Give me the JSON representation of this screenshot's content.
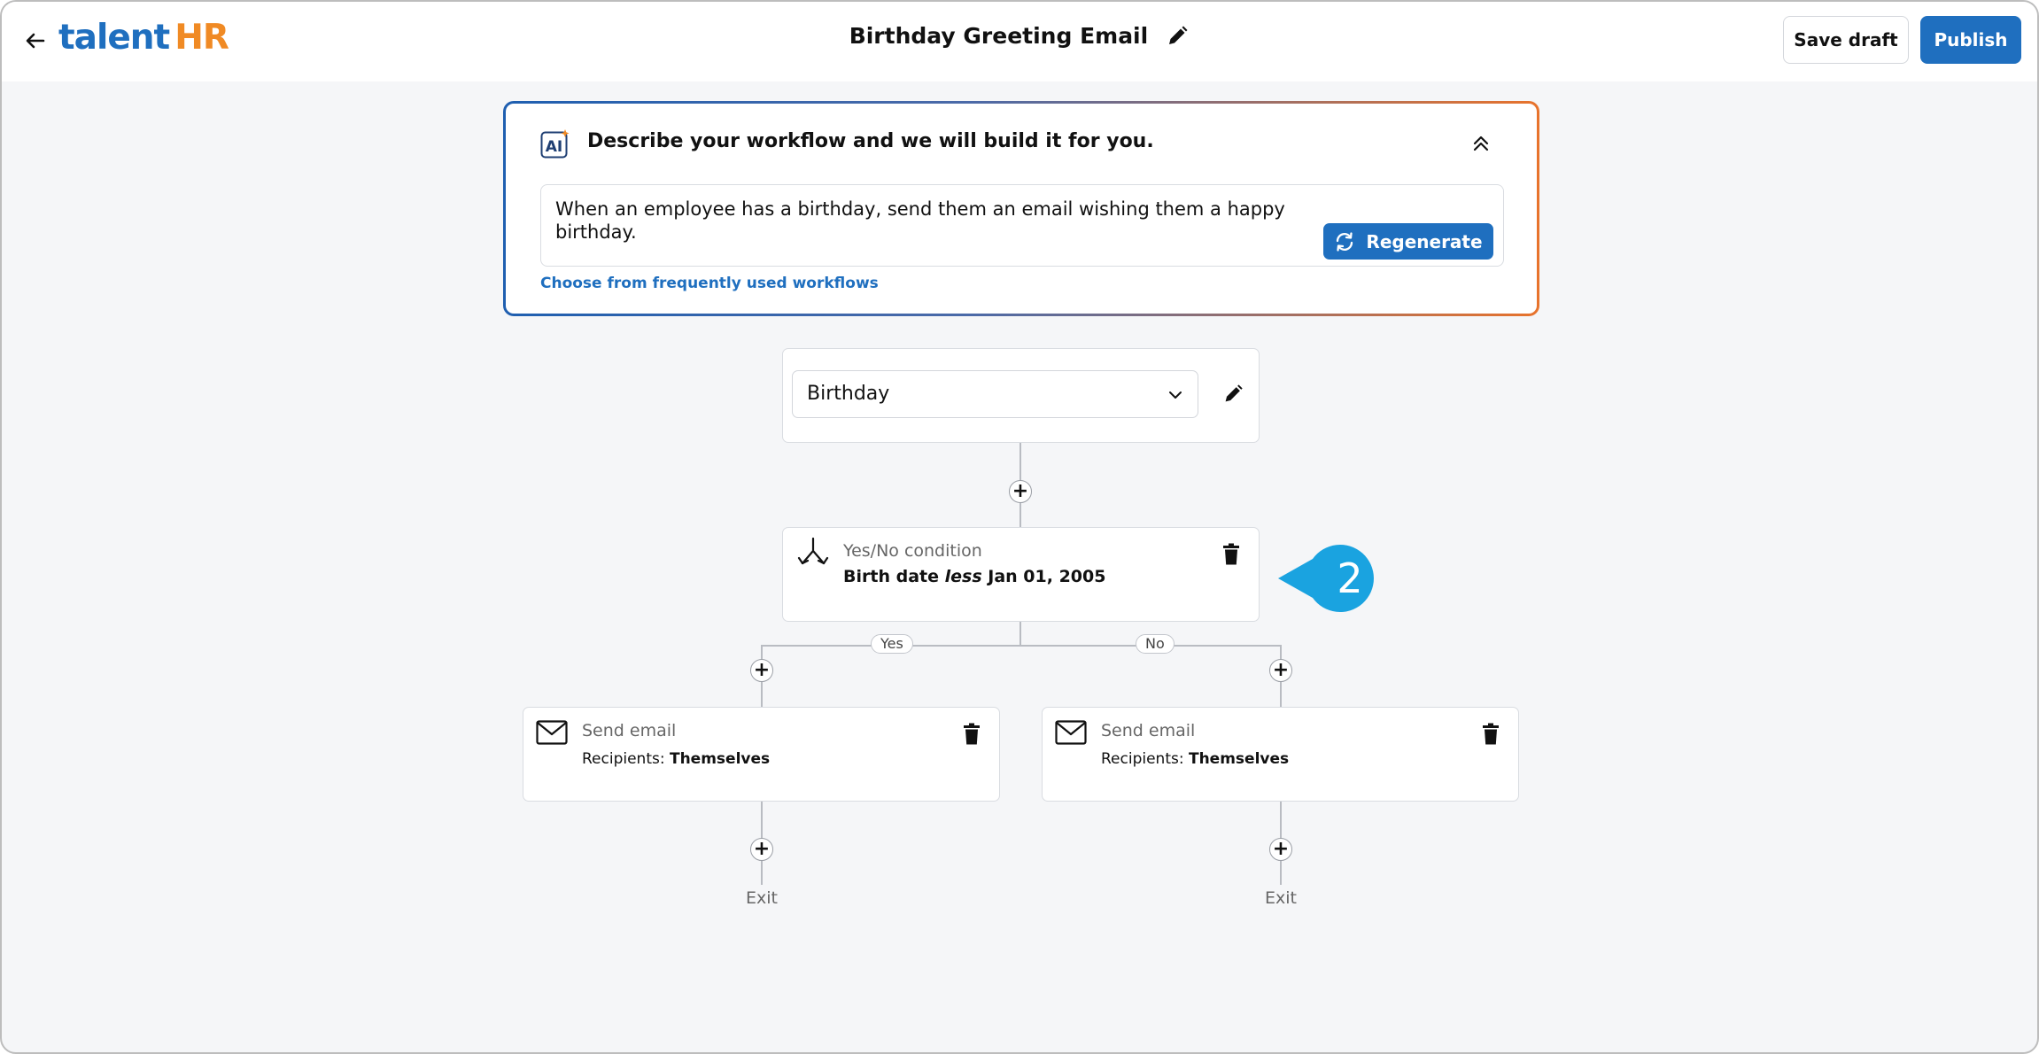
{
  "header": {
    "logo_talent": "talent",
    "logo_hr": "HR",
    "title": "Birthday Greeting Email",
    "save_draft_label": "Save draft",
    "publish_label": "Publish"
  },
  "ai_panel": {
    "badge_text": "AI",
    "heading": "Describe your workflow and we will build it for you.",
    "prompt": "When an employee has a birthday, send them an email wishing them a happy birthday.",
    "regenerate_label": "Regenerate",
    "frequent_link": "Choose from frequently used workflows"
  },
  "trigger": {
    "selected": "Birthday"
  },
  "condition": {
    "type_label": "Yes/No condition",
    "field": "Birth date",
    "operator": "less",
    "value": "Jan 01, 2005"
  },
  "branches": {
    "yes_label": "Yes",
    "no_label": "No"
  },
  "actions": [
    {
      "type_label": "Send email",
      "recipients_label": "Recipients:",
      "recipients_value": "Themselves"
    },
    {
      "type_label": "Send email",
      "recipients_label": "Recipients:",
      "recipients_value": "Themselves"
    }
  ],
  "exit_label": "Exit",
  "callout_number": "2",
  "colors": {
    "brand_blue": "#1f6fbf",
    "brand_orange": "#f08a24",
    "callout_blue": "#1aa3e0"
  },
  "icons": [
    "back-arrow-icon",
    "pencil-icon",
    "ai-sparkle-icon",
    "chevrons-up-icon",
    "refresh-icon",
    "chevron-down-icon",
    "split-icon",
    "trash-icon",
    "mail-icon",
    "plus-icon"
  ]
}
